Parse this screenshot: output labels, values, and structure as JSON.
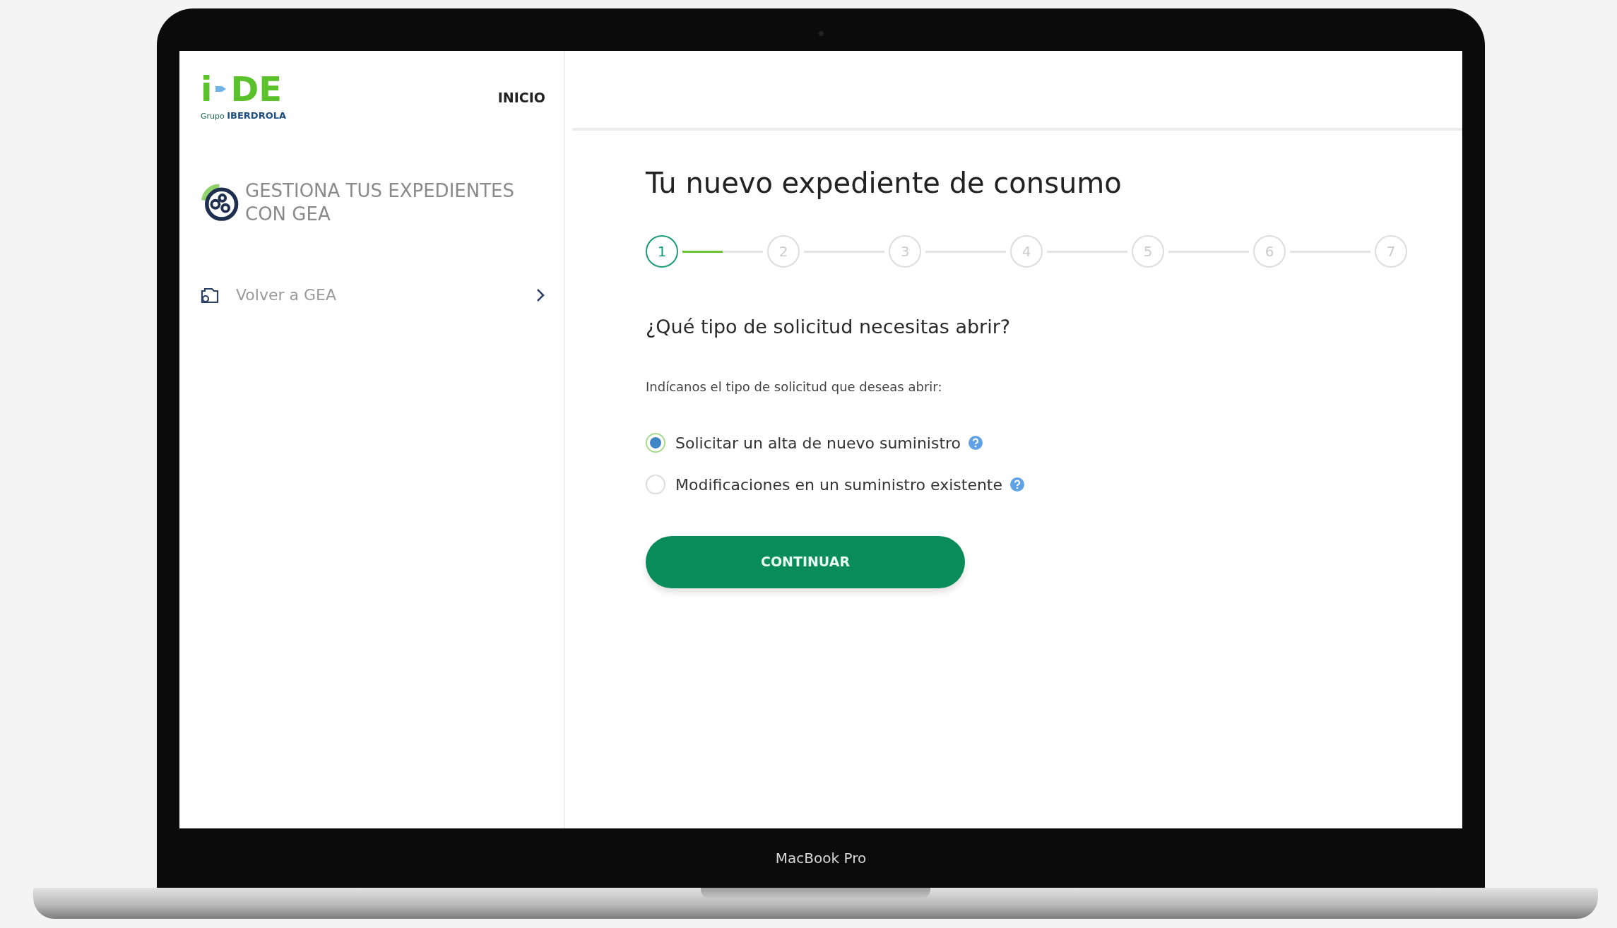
{
  "device": {
    "label": "MacBook Pro"
  },
  "sidebar": {
    "logo": {
      "letter": "i",
      "name": "DE",
      "group_prefix": "Grupo",
      "group": "IBERDROLA"
    },
    "nav_link": "INICIO",
    "heading": "GESTIONA TUS EXPEDIENTES CON GEA",
    "items": [
      {
        "label": "Volver a GEA"
      }
    ]
  },
  "main": {
    "title": "Tu nuevo expediente de consumo",
    "steps": [
      {
        "label": "1",
        "selected": true,
        "level": 0.5
      },
      {
        "label": "2",
        "selected": false,
        "level": 0
      },
      {
        "label": "3",
        "selected": false,
        "level": 0
      },
      {
        "label": "4",
        "selected": false,
        "level": 0
      },
      {
        "label": "5",
        "selected": false,
        "level": 0
      },
      {
        "label": "6",
        "selected": false,
        "level": 0
      },
      {
        "label": "7",
        "selected": false
      }
    ],
    "question": "¿Qué tipo de solicitud necesitas abrir?",
    "instruction": "Indícanos el tipo de solicitud que deseas abrir:",
    "options": [
      {
        "label": "Solicitar un alta de nuevo suministro",
        "selected": true
      },
      {
        "label": "Modificaciones en un suministro existente",
        "selected": false
      }
    ],
    "button": "CONTINUAR"
  }
}
